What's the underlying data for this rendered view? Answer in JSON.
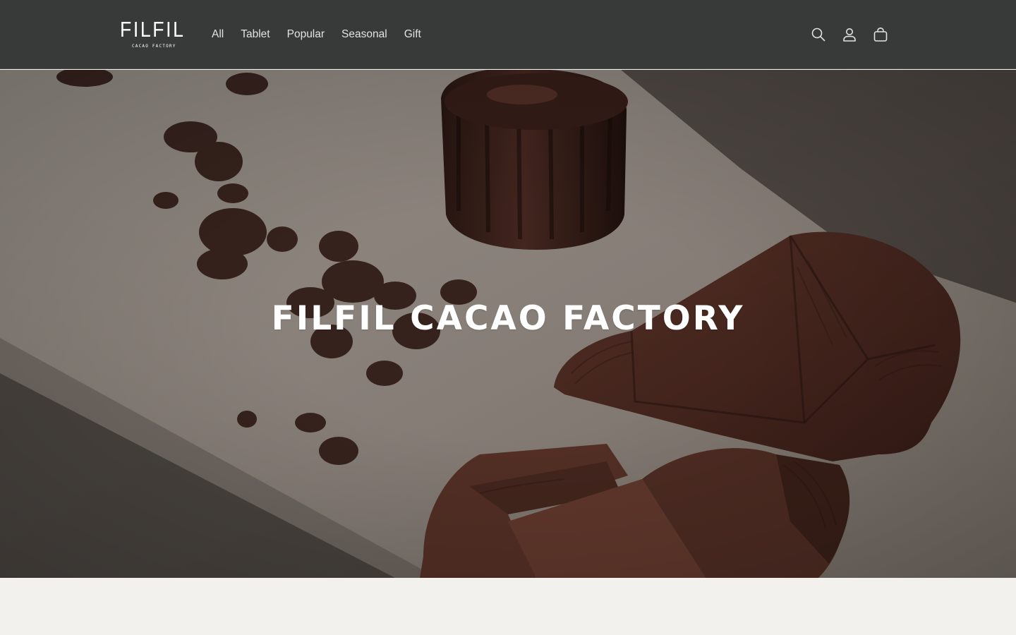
{
  "brand": {
    "logo_main": "FILFIL",
    "logo_sub": "CACAO FACTORY"
  },
  "nav": {
    "items": [
      "All",
      "Tablet",
      "Popular",
      "Seasonal",
      "Gift"
    ]
  },
  "header_icons": [
    "search-icon",
    "account-icon",
    "cart-icon"
  ],
  "hero": {
    "title": "FILFIL CACAO FACTORY"
  },
  "colors": {
    "header_bg": "#383a39",
    "page_bg": "#f2f1ee",
    "text_light": "#ffffff"
  }
}
